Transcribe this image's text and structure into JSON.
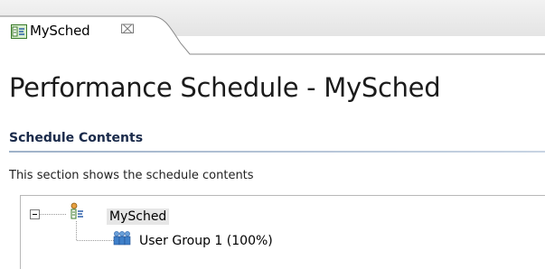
{
  "editor": {
    "tab_label": "MySched",
    "close_glyph": "⌧"
  },
  "page": {
    "title": "Performance Schedule - MySched"
  },
  "section": {
    "title": "Schedule Contents",
    "description": "This section shows the schedule contents"
  },
  "tree": {
    "root_label": "MySched",
    "children": [
      {
        "label": "User Group 1 (100%)",
        "icon": "user-group-icon"
      }
    ]
  },
  "icons": {
    "tab": "schedule-icon",
    "expander": "collapse-icon",
    "root": "schedule-node-icon"
  }
}
